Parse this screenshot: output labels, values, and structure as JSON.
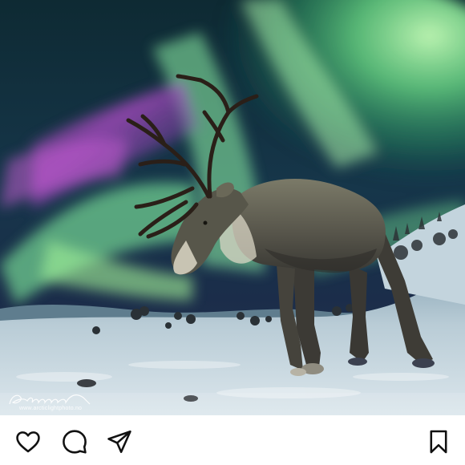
{
  "post": {
    "watermark": {
      "signature": "Solnorman",
      "url": "www.arcticlightphoto.no"
    },
    "actions": {
      "like": "heart-icon",
      "comment": "comment-icon",
      "share": "send-icon",
      "save": "bookmark-icon"
    }
  }
}
